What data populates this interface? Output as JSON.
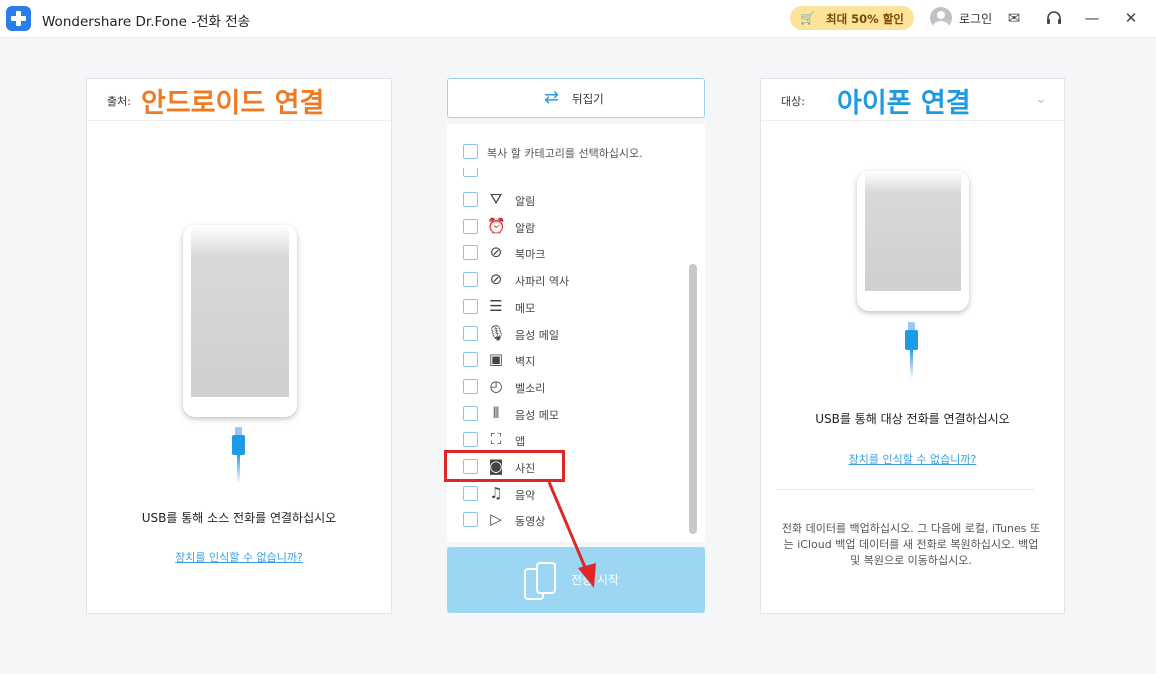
{
  "titlebar": {
    "app_title": "Wondershare Dr.Fone -전화 전송",
    "promo": "최대 50% 할인",
    "promo_icon": "cart-icon",
    "login": "로그인",
    "icons": [
      "mail-icon",
      "headset-icon",
      "minimize-icon",
      "close-icon"
    ]
  },
  "source": {
    "label": "출처:",
    "title": "안드로이드 연결",
    "title_color": "#ef7a22",
    "connect_msg": "USB를 통해 소스 전화를 연결하십시오",
    "link": "장치를 인식할 수 없습니까?"
  },
  "target": {
    "label": "대상:",
    "title": "아이폰 연결",
    "title_color": "#1e9ae0",
    "connect_msg": "USB를 통해 대상 전화를 연결하십시오",
    "link": "장치를 인식할 수 없습니까?",
    "note": "전화 데이터를 백업하십시오. 그 다음에 로컬, iTunes 또는 iCloud 백업 데이터를 새 전화로 복원하십시오. 백업 및 복원으로 이동하십시오."
  },
  "middle": {
    "flip_label": "뒤집기",
    "hint": "복사 할 카테고리를 선택하십시오.",
    "categories": [
      {
        "label": "알림",
        "icon": "notification-icon"
      },
      {
        "label": "알람",
        "icon": "alarm-icon"
      },
      {
        "label": "북마크",
        "icon": "bookmark-icon"
      },
      {
        "label": "사파리 역사",
        "icon": "safari-icon"
      },
      {
        "label": "메모",
        "icon": "memo-icon"
      },
      {
        "label": "음성 메일",
        "icon": "microphone-icon"
      },
      {
        "label": "벽지",
        "icon": "wallpaper-icon"
      },
      {
        "label": "벨소리",
        "icon": "ringtone-icon"
      },
      {
        "label": "음성 메모",
        "icon": "waveform-icon"
      },
      {
        "label": "앱",
        "icon": "app-icon"
      },
      {
        "label": "사진",
        "icon": "camera-icon"
      },
      {
        "label": "음악",
        "icon": "music-icon"
      },
      {
        "label": "동영상",
        "icon": "video-icon"
      }
    ],
    "start_label": "전송 시작"
  },
  "colors": {
    "accent": "#2d9ae6",
    "highlight": "#e02727",
    "start_button": "#9dd6f3"
  }
}
